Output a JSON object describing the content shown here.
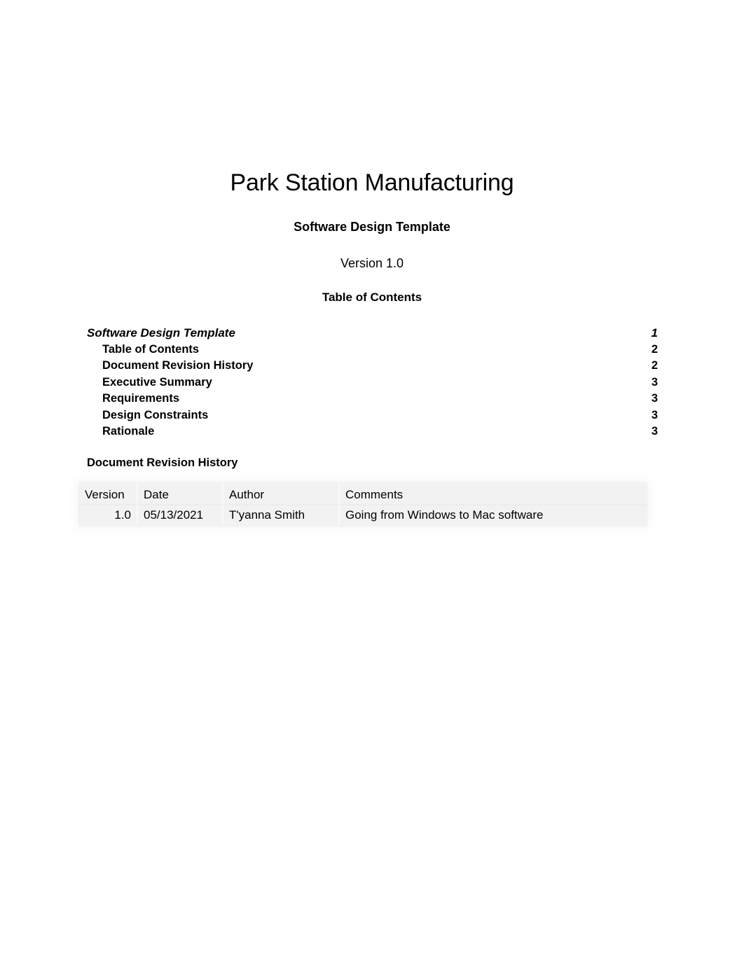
{
  "document": {
    "title": "Park Station Manufacturing",
    "subtitle": "Software Design Template",
    "version_line": "Version 1.0",
    "toc_heading": "Table of Contents"
  },
  "toc": {
    "entries": [
      {
        "label": "Software Design Template",
        "page": "1",
        "level": 1
      },
      {
        "label": "Table of Contents",
        "page": "2",
        "level": 2
      },
      {
        "label": "Document Revision History",
        "page": "2",
        "level": 2
      },
      {
        "label": "Executive Summary",
        "page": "3",
        "level": 2
      },
      {
        "label": "Requirements",
        "page": "3",
        "level": 2
      },
      {
        "label": "Design Constraints",
        "page": "3",
        "level": 2
      },
      {
        "label": "Rationale",
        "page": "3",
        "level": 2
      }
    ]
  },
  "revision_history": {
    "heading": "Document Revision History",
    "columns": [
      "Version",
      "Date",
      "Author",
      "Comments"
    ],
    "rows": [
      {
        "version": "1.0",
        "date": "05/13/2021",
        "author": "T'yanna Smith",
        "comments": "Going from Windows to Mac software"
      }
    ]
  },
  "colors": {
    "page_background": "#ffffff",
    "text": "#000000",
    "table_cell_background": "#f2f2f2",
    "table_gridline": "#ffffff"
  }
}
